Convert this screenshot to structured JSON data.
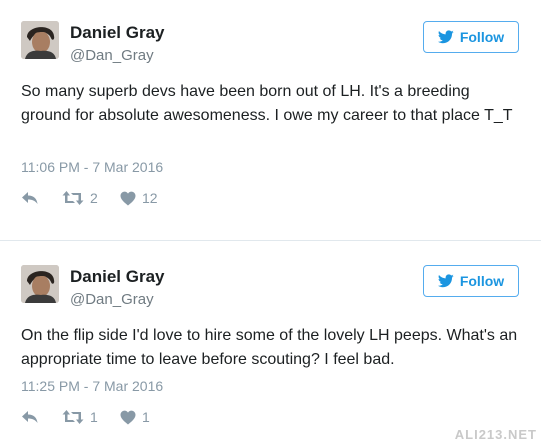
{
  "tweets": [
    {
      "name": "Daniel Gray",
      "handle": "@Dan_Gray",
      "follow_label": "Follow",
      "text": "So many superb devs have been born out of LH. It's a breeding ground for absolute awesomeness. I owe my career to that place T_T",
      "timestamp": "11:06 PM - 7 Mar 2016",
      "retweets": "2",
      "likes": "12"
    },
    {
      "name": "Daniel Gray",
      "handle": "@Dan_Gray",
      "follow_label": "Follow",
      "text": "On the flip side I'd love to hire some of the lovely LH peeps. What's an appropriate time to leave before scouting? I feel bad.",
      "timestamp": "11:25 PM - 7 Mar 2016",
      "retweets": "1",
      "likes": "1"
    }
  ],
  "watermark": "ALI213.NET",
  "colors": {
    "follow_border": "#55acee",
    "follow_text": "#1b95e0",
    "muted": "#8899a6",
    "divider": "#e1e8ed"
  },
  "icons": [
    "avatar-photo",
    "twitter-bird-icon",
    "reply-icon",
    "retweet-icon",
    "heart-icon"
  ]
}
